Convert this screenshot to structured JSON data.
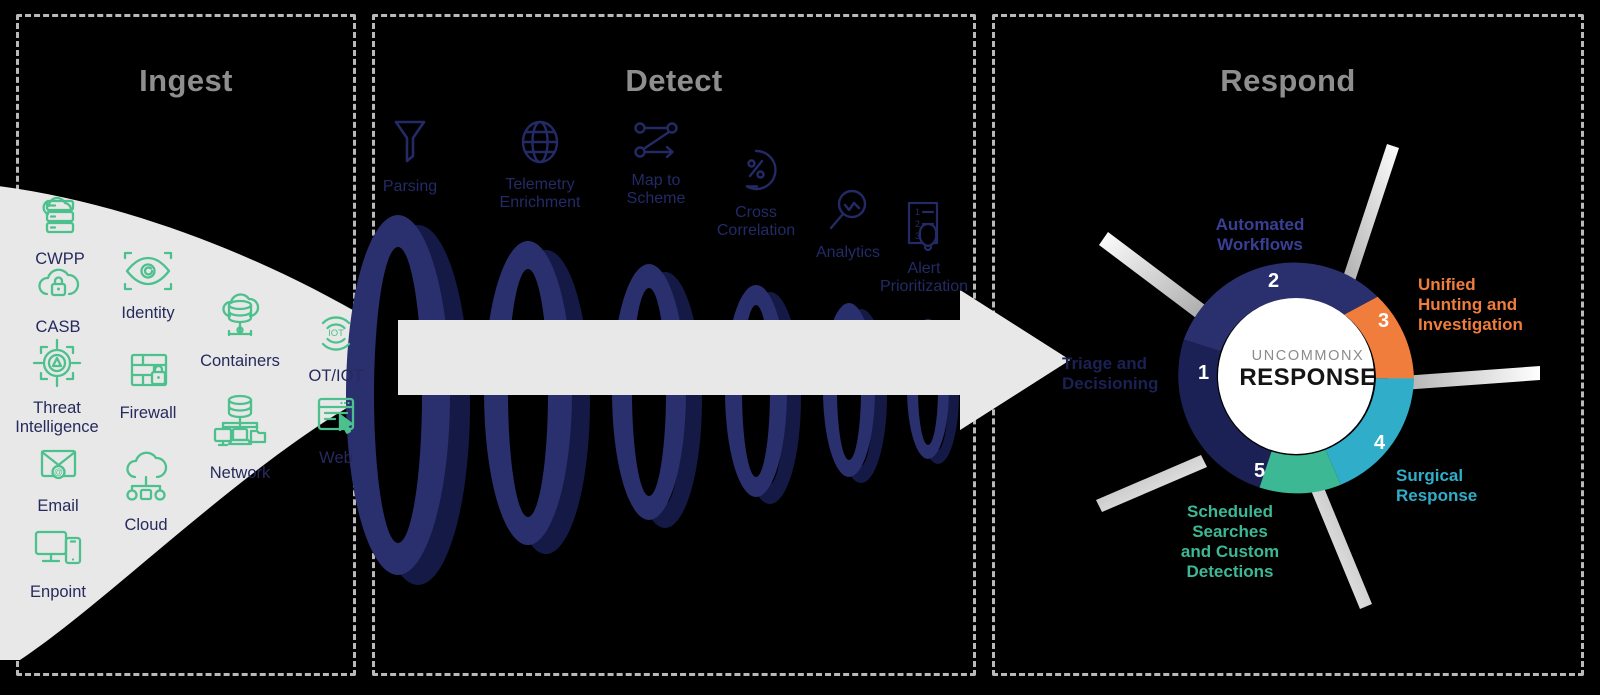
{
  "panels": [
    {
      "id": "ingest",
      "title": "Ingest"
    },
    {
      "id": "detect",
      "title": "Detect"
    },
    {
      "id": "respond",
      "title": "Respond"
    }
  ],
  "ingest": {
    "title": "Ingest",
    "sources": [
      {
        "label": "CWPP",
        "icon": "cloud-server-icon"
      },
      {
        "label": "Identity",
        "icon": "eye-scan-icon"
      },
      {
        "label": "CASB",
        "icon": "cloud-lock-icon"
      },
      {
        "label": "Containers",
        "icon": "cloud-database-icon"
      },
      {
        "label": "OT/IOT",
        "icon": "iot-signal-icon"
      },
      {
        "label": "Threat\nIntelligence",
        "icon": "threat-target-icon"
      },
      {
        "label": "Firewall",
        "icon": "firewall-lock-icon"
      },
      {
        "label": "Network",
        "icon": "network-nodes-icon"
      },
      {
        "label": "Web",
        "icon": "browser-cursor-icon"
      },
      {
        "label": "Email",
        "icon": "email-at-icon"
      },
      {
        "label": "Cloud",
        "icon": "cloud-network-icon"
      },
      {
        "label": "Enpoint",
        "icon": "desktop-mobile-icon"
      }
    ]
  },
  "detect": {
    "title": "Detect",
    "stages": [
      {
        "label": "Parsing",
        "icon": "funnel-icon"
      },
      {
        "label": "Telemetry\nEnrichment",
        "icon": "globe-icon"
      },
      {
        "label": "Map to\nScheme",
        "icon": "map-nodes-icon"
      },
      {
        "label": "Cross\nCorrelation",
        "icon": "percent-gauge-icon"
      },
      {
        "label": "Analytics",
        "icon": "magnifier-chart-icon"
      },
      {
        "label": "Alert\nPrioritization",
        "icon": "priority-list-bell-icon"
      }
    ],
    "ring_count": 6
  },
  "respond": {
    "title": "Respond",
    "center_brand": "UNCOMMONX",
    "center_word": "RESPONSE",
    "segments": [
      {
        "number": "1",
        "label": "Triage and\nDecisioning",
        "color": "#1b2154"
      },
      {
        "number": "2",
        "label": "Automated\nWorkflows",
        "color": "#2a2f6e"
      },
      {
        "number": "3",
        "label": "Unified\nHunting and\nInvestigation",
        "color": "#f07d3c"
      },
      {
        "number": "4",
        "label": "Surgical\nResponse",
        "color": "#2fadc9"
      },
      {
        "number": "5",
        "label": "Scheduled\nSearches\nand Custom\nDetections",
        "color": "#3cb894"
      }
    ]
  },
  "colors": {
    "background": "#000000",
    "panel_border": "#b9b9b9",
    "panel_title": "#8e8e8e",
    "funnel_gray": "#e8e8e8",
    "ring_front": "#2a2f6e",
    "ring_back": "#141a45",
    "ingest_icon_green": "#4cc08d",
    "ingest_label_navy": "#262a5c",
    "detect_navy": "#232a66",
    "pointer_gray": "#b5b5b5"
  },
  "chart_data": {
    "type": "pie",
    "title": "UNCOMMONX RESPONSE",
    "categories": [
      "Triage and Decisioning",
      "Automated Workflows",
      "Unified Hunting and Investigation",
      "Surgical Response",
      "Scheduled Searches and Custom Detections"
    ],
    "values": [
      20,
      20,
      20,
      20,
      20
    ],
    "colors": [
      "#1b2154",
      "#2a2f6e",
      "#f07d3c",
      "#2fadc9",
      "#3cb894"
    ],
    "labels": [
      "1",
      "2",
      "3",
      "4",
      "5"
    ],
    "legend_position": "radial-callouts",
    "donut": true
  }
}
